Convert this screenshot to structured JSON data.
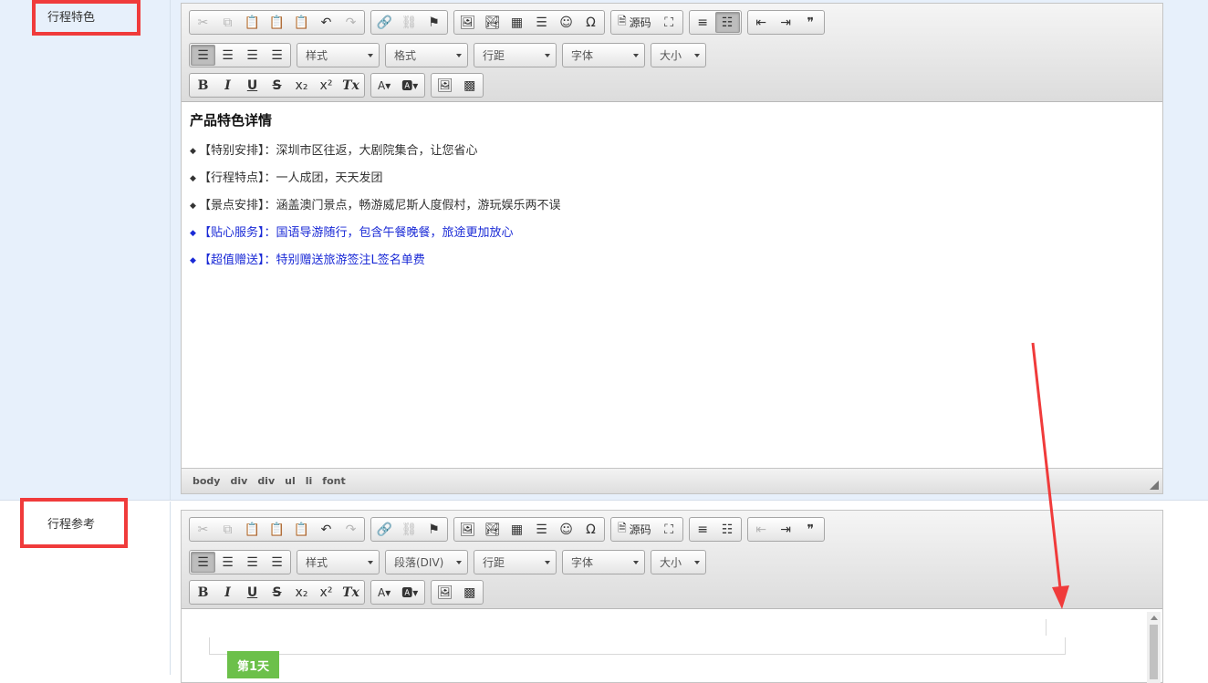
{
  "rows": [
    {
      "label": "行程特色"
    },
    {
      "label": "行程参考"
    }
  ],
  "toolbar": {
    "source_label": "源码",
    "selects1": [
      "样式",
      "格式",
      "行距",
      "字体",
      "大小"
    ],
    "selects2": [
      "样式",
      "段落(DIV)",
      "行距",
      "字体",
      "大小"
    ],
    "bold": "B",
    "italic": "I",
    "underline": "U",
    "strike": "S",
    "clear_format": "Tx"
  },
  "editor1": {
    "heading": "产品特色详情",
    "items": [
      {
        "text": "【特别安排】：深圳市区往返，大剧院集合，让您省心",
        "color": "#333333"
      },
      {
        "text": "【行程特点】：一人成团，天天发团",
        "color": "#333333"
      },
      {
        "text": "【景点安排】：涵盖澳门景点，畅游威尼斯人度假村，游玩娱乐两不误",
        "color": "#333333"
      },
      {
        "text": "【贴心服务】：国语导游随行，包含午餐晚餐，旅途更加放心",
        "color": "#1a2ad6"
      },
      {
        "text": "【超值赠送】：特别赠送旅游签注L签名单费",
        "color": "#1a2ad6"
      }
    ],
    "path": [
      "body",
      "div",
      "div",
      "ul",
      "li",
      "font"
    ]
  },
  "editor2": {
    "day_tag": "第1天"
  },
  "colors": {
    "highlight": "#f03b3b",
    "day_tag": "#6cc04a",
    "blue_text": "#1a2ad6"
  }
}
